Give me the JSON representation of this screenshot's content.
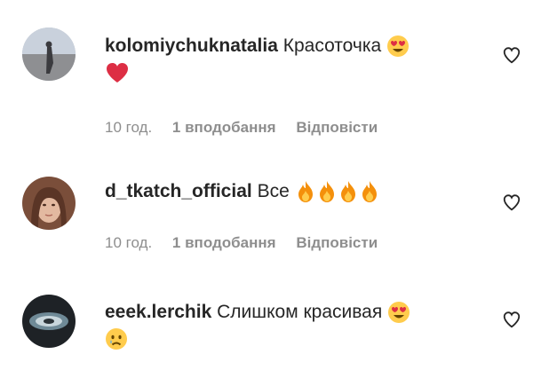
{
  "comments": [
    {
      "username": "kolomiychuknatalia",
      "text": "Красоточка",
      "emojis": [
        "heart-eyes",
        "red-heart"
      ],
      "time": "10 год.",
      "likes": "1 вподобання",
      "reply": "Відповісти"
    },
    {
      "username": "d_tkatch_official",
      "text": "Все",
      "emojis": [
        "fire",
        "fire",
        "fire",
        "fire"
      ],
      "time": "10 год.",
      "likes": "1 вподобання",
      "reply": "Відповісти"
    },
    {
      "username": "eeek.lerchik",
      "text": "Слишком красивая",
      "emojis": [
        "heart-eyes",
        "crying-face"
      ]
    }
  ],
  "colors": {
    "text": "#262626",
    "meta": "#8e8e8e",
    "heart": "#ed4956",
    "emoji_yellow": "#ffcc4d",
    "fire": "#f4900c"
  }
}
